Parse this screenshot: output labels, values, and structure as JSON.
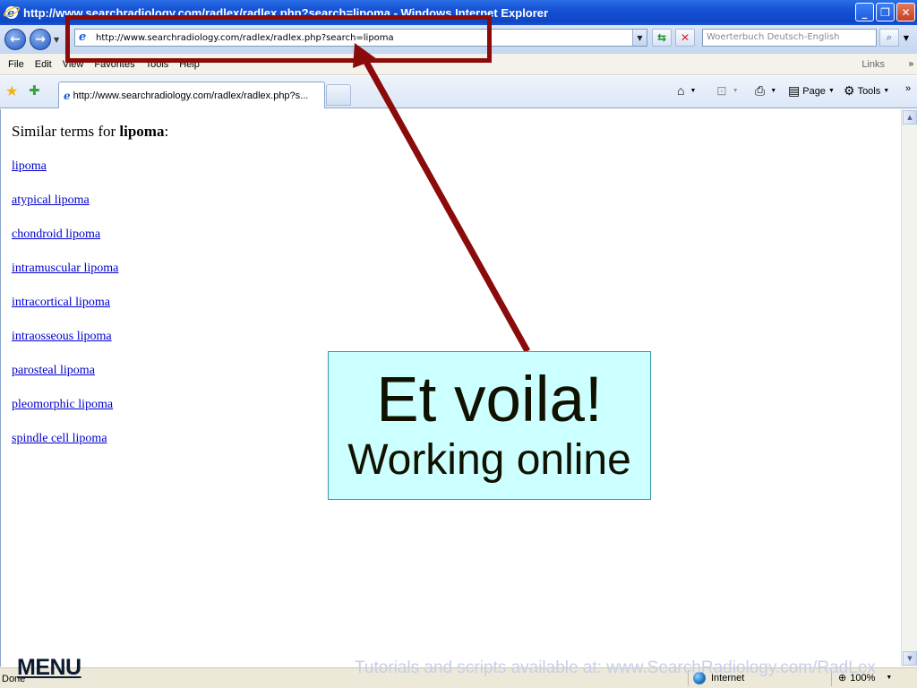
{
  "window": {
    "title": "http://www.searchradiology.com/radlex/radlex.php?search=lipoma - Windows Internet Explorer",
    "controls": {
      "minimize": "_",
      "maximize": "❐",
      "close": "✕"
    }
  },
  "address_bar": {
    "url": "http://www.searchradiology.com/radlex/radlex.php?search=lipoma",
    "search_placeholder": "Woerterbuch Deutsch-English"
  },
  "menu": {
    "items": [
      "File",
      "Edit",
      "View",
      "Favorites",
      "Tools",
      "Help"
    ],
    "links_label": "Links"
  },
  "tabs": {
    "active_title": "http://www.searchradiology.com/radlex/radlex.php?s..."
  },
  "command_bar": {
    "page_label": "Page",
    "tools_label": "Tools"
  },
  "page": {
    "heading_prefix": "Similar terms for ",
    "heading_term": "lipoma",
    "heading_suffix": ":",
    "terms": [
      "lipoma",
      "atypical lipoma",
      "chondroid lipoma",
      "intramuscular lipoma",
      "intracortical lipoma",
      "intraosseous lipoma",
      "parosteal lipoma",
      "pleomorphic lipoma",
      "spindle cell lipoma"
    ]
  },
  "status": {
    "text": "Done",
    "zone": "Internet",
    "zoom": "100%"
  },
  "overlay": {
    "callout_title": "Et voila!",
    "callout_subtitle": "Working online",
    "menu_label": "MENU",
    "watermark": "Tutorials and scripts available at: www.SearchRadiology.com/RadLex",
    "arrow_color": "#8b0a0a",
    "callout_bg": "#ccffff"
  }
}
